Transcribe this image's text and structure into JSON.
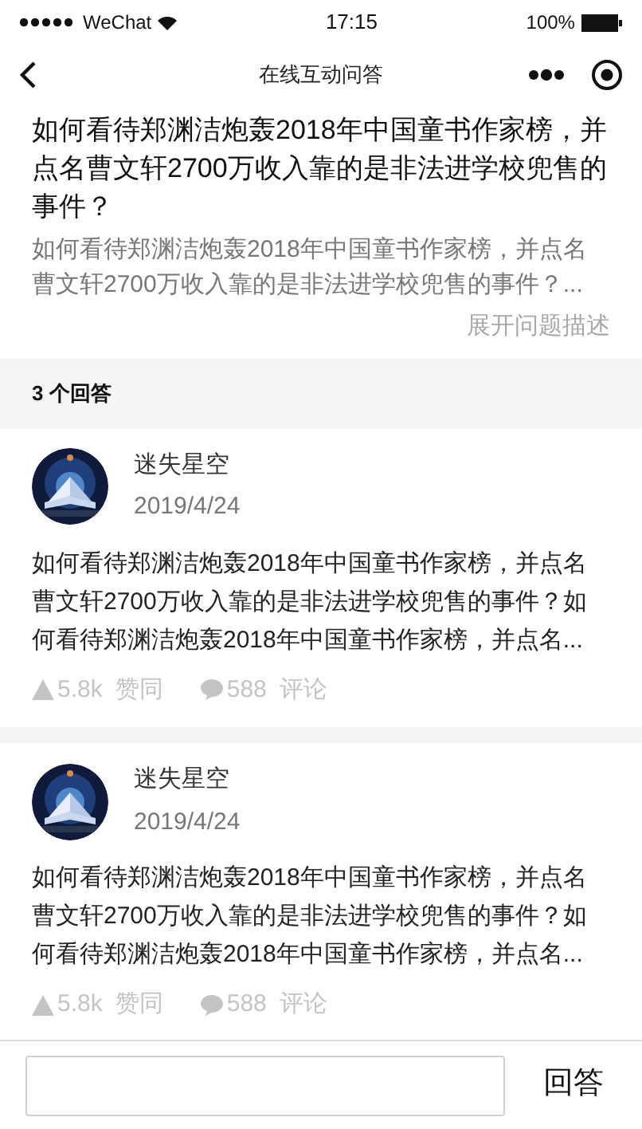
{
  "status_bar": {
    "carrier": "WeChat",
    "time": "17:15",
    "battery": "100%"
  },
  "nav": {
    "title": "在线互动问答"
  },
  "question": {
    "title": "如何看待郑渊洁炮轰2018年中国童书作家榜，并点名曹文轩2700万收入靠的是非法进学校兜售的事件？",
    "description": "如何看待郑渊洁炮轰2018年中国童书作家榜，并点名曹文轩2700万收入靠的是非法进学校兜售的事件？...",
    "expand_link": "展开问题描述"
  },
  "answers_header": "3 个回答",
  "answers": [
    {
      "author": "迷失星空",
      "date": "2019/4/24",
      "text": "如何看待郑渊洁炮轰2018年中国童书作家榜，并点名曹文轩2700万收入靠的是非法进学校兜售的事件？如何看待郑渊洁炮轰2018年中国童书作家榜，并点名...",
      "likes": "5.8k",
      "like_label": "赞同",
      "comments": "588",
      "comment_label": "评论"
    },
    {
      "author": "迷失星空",
      "date": "2019/4/24",
      "text": "如何看待郑渊洁炮轰2018年中国童书作家榜，并点名曹文轩2700万收入靠的是非法进学校兜售的事件？如何看待郑渊洁炮轰2018年中国童书作家榜，并点名...",
      "likes": "5.8k",
      "like_label": "赞同",
      "comments": "588",
      "comment_label": "评论"
    }
  ],
  "reply_bar": {
    "button": "回答"
  }
}
